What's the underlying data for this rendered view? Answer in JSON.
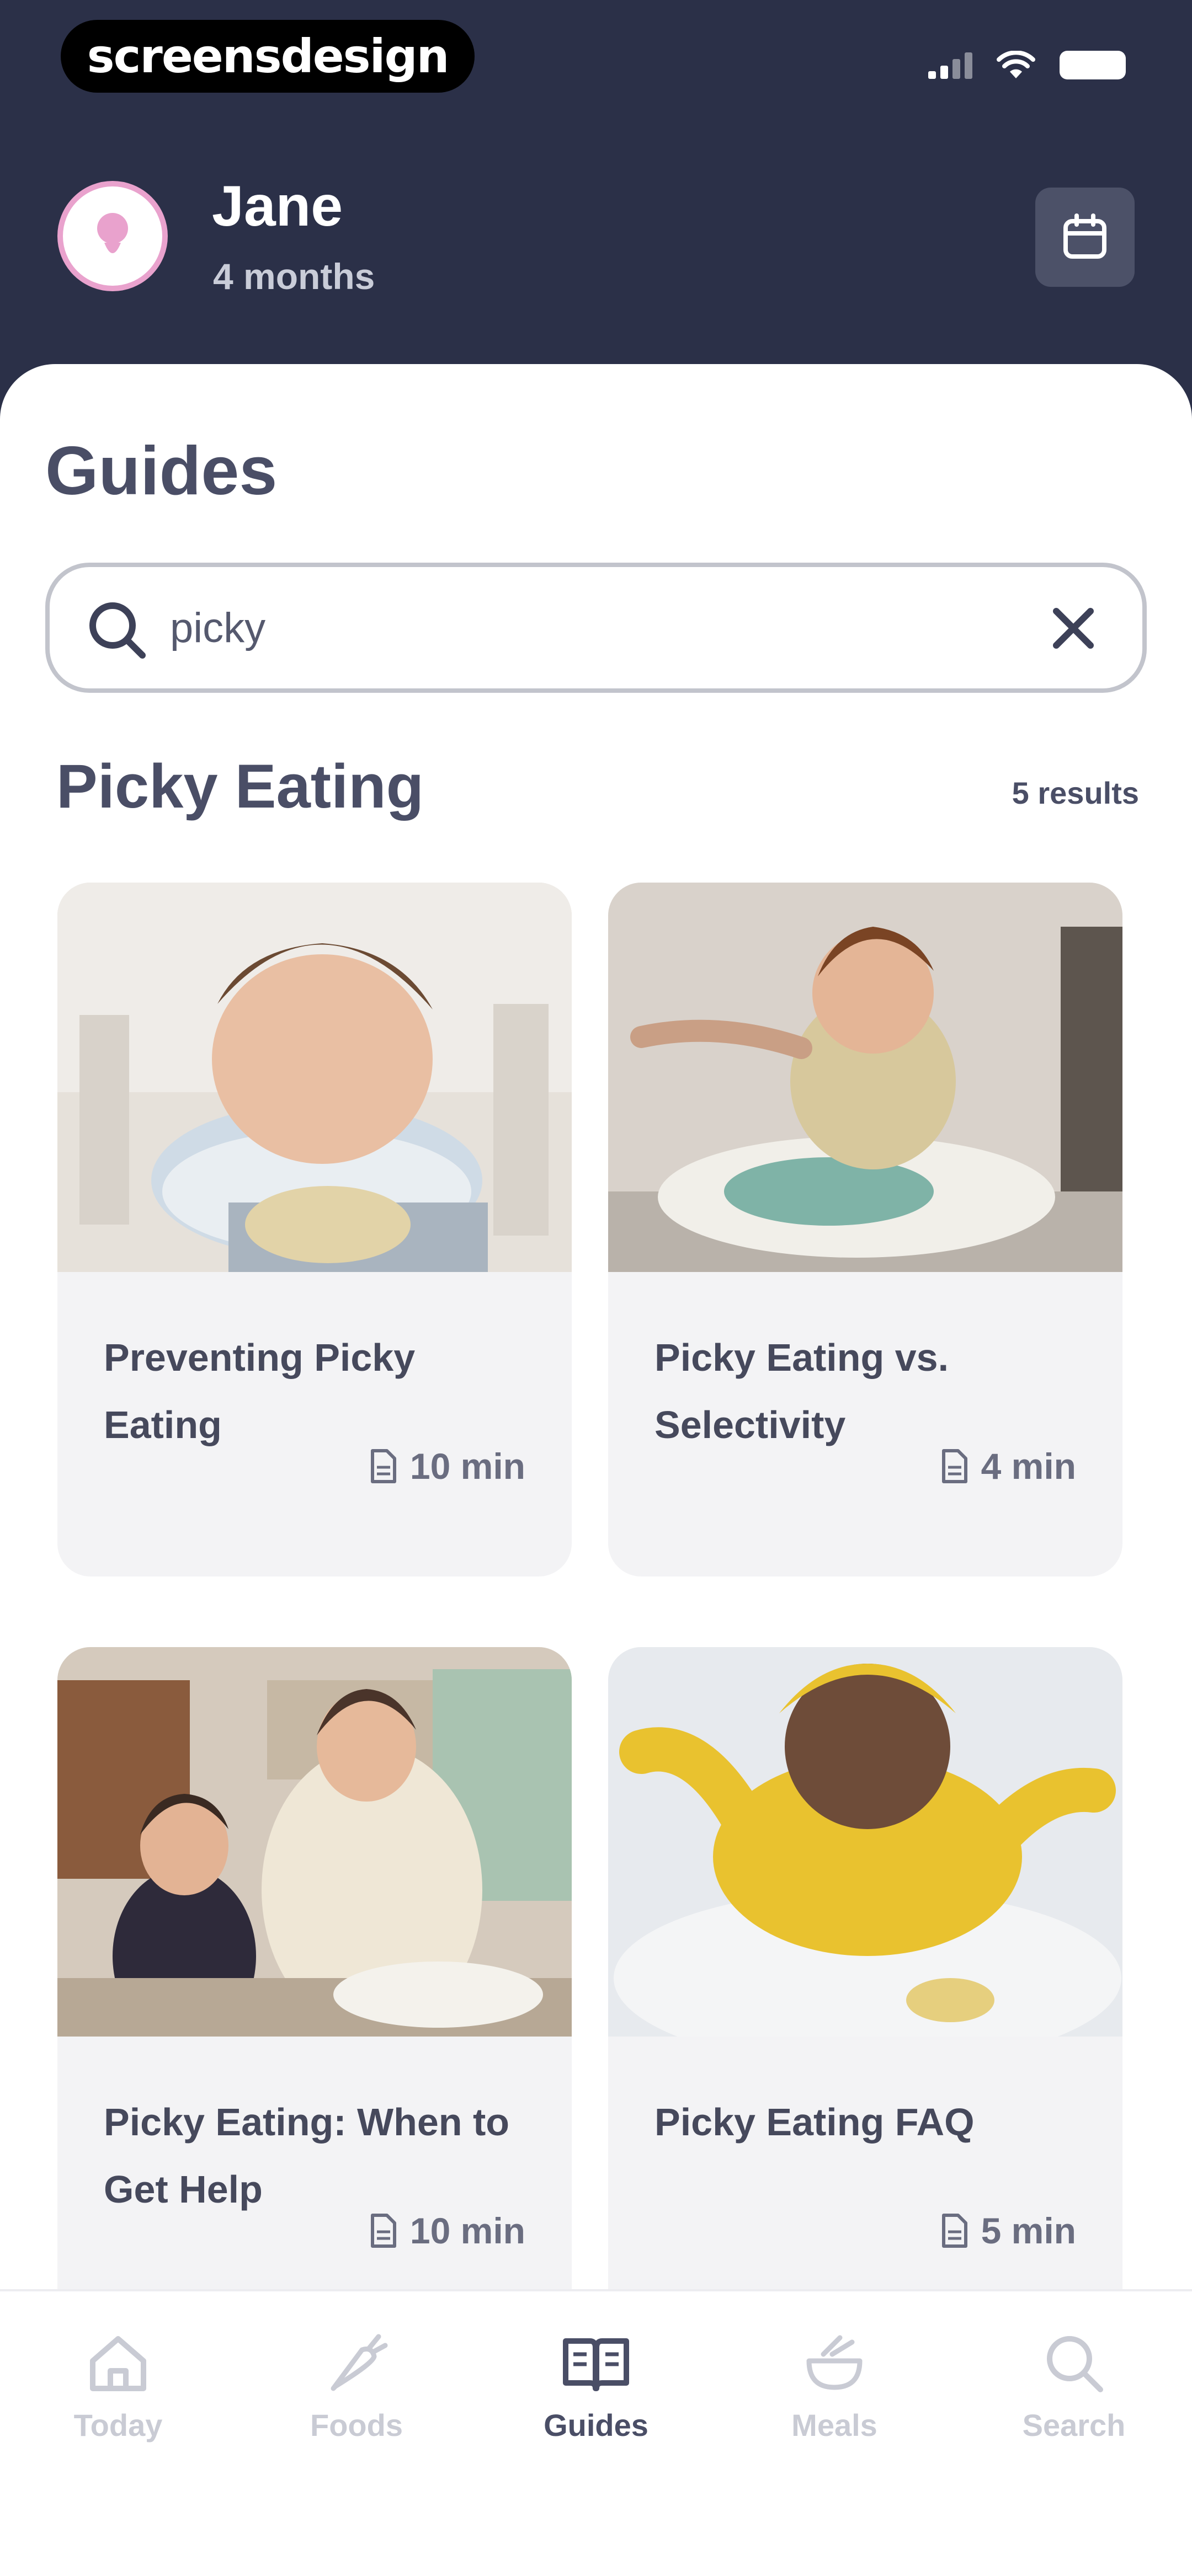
{
  "status_bar": {
    "watermark": "screensdesign"
  },
  "profile": {
    "name": "Jane",
    "age": "4 months"
  },
  "guides": {
    "title": "Guides",
    "search": {
      "value": "picky",
      "placeholder": ""
    },
    "section_title": "Picky Eating",
    "result_count": "5 results",
    "cards": [
      {
        "title": "Preventing Picky Eating",
        "duration": "10 min"
      },
      {
        "title": "Picky Eating vs. Selectivity",
        "duration": "4 min"
      },
      {
        "title": "Picky Eating: When to Get Help",
        "duration": "10 min"
      },
      {
        "title": "Picky Eating FAQ",
        "duration": "5 min"
      }
    ]
  },
  "tabbar": {
    "active": "Guides",
    "tabs": [
      {
        "label": "Today",
        "icon": "home-icon"
      },
      {
        "label": "Foods",
        "icon": "carrot-icon"
      },
      {
        "label": "Guides",
        "icon": "book-icon"
      },
      {
        "label": "Meals",
        "icon": "bowl-icon"
      },
      {
        "label": "Search",
        "icon": "search-icon"
      }
    ]
  },
  "colors": {
    "header_bg": "#2b3048",
    "avatar_ring": "#e9a2cd",
    "card_bg": "#f3f3f5",
    "text_dark": "#4a4e66",
    "tab_inactive": "#c9cbd4"
  }
}
